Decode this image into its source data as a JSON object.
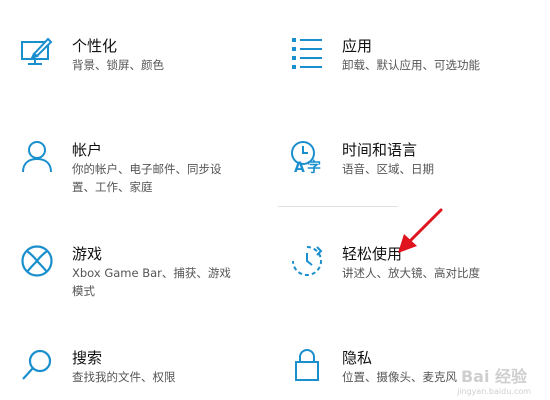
{
  "colors": {
    "accent": "#1a8fce",
    "arrow": "#e0141e"
  },
  "tiles": [
    {
      "title": "个性化",
      "desc": "背景、锁屏、颜色",
      "icon": "personalization-icon"
    },
    {
      "title": "应用",
      "desc": "卸载、默认应用、可选功能",
      "icon": "apps-icon"
    },
    {
      "title": "帐户",
      "desc": "你的帐户、电子邮件、同步设置、工作、家庭",
      "icon": "account-icon"
    },
    {
      "title": "时间和语言",
      "desc": "语音、区域、日期",
      "icon": "time-language-icon"
    },
    {
      "title": "游戏",
      "desc": "Xbox Game Bar、捕获、游戏模式",
      "icon": "xbox-icon"
    },
    {
      "title": "轻松使用",
      "desc": "讲述人、放大镜、高对比度",
      "icon": "ease-of-access-icon"
    },
    {
      "title": "搜索",
      "desc": "查找我的文件、权限",
      "icon": "search-icon"
    },
    {
      "title": "隐私",
      "desc": "位置、摄像头、麦克风",
      "icon": "lock-icon"
    }
  ],
  "watermark": {
    "text": "Bai 经验",
    "subtext": "jingyan.baidu.com"
  }
}
